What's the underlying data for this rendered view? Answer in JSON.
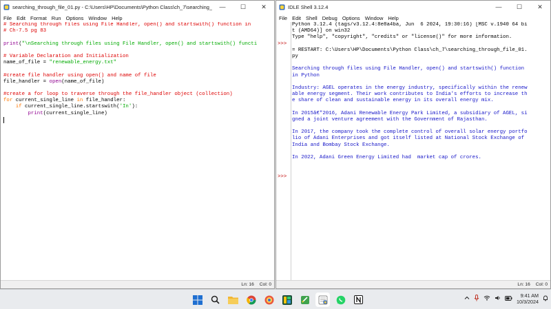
{
  "editor": {
    "title": "searching_through_file_01.py - C:\\Users\\HP\\Documents\\Python Class\\ch_7\\searching_through_f...",
    "menu": [
      "File",
      "Edit",
      "Format",
      "Run",
      "Options",
      "Window",
      "Help"
    ],
    "lines": [
      [
        {
          "t": "# Searching through files using File Handler, open() and startswith() function in",
          "c": "comment"
        }
      ],
      [
        {
          "t": "# Ch-7.5 pg 83",
          "c": "comment"
        }
      ],
      [],
      [
        {
          "t": "print",
          "c": "builtin"
        },
        {
          "t": "(",
          "c": "normal"
        },
        {
          "t": "\"\\nSearching through files using File Handler, open() and startswith() functi",
          "c": "string"
        }
      ],
      [],
      [
        {
          "t": "# Variable Declaration and Initialization",
          "c": "comment"
        }
      ],
      [
        {
          "t": "name_of_file = ",
          "c": "normal"
        },
        {
          "t": "\"renewable_energy.txt\"",
          "c": "string"
        }
      ],
      [],
      [
        {
          "t": "#create file handler using open() and name of file",
          "c": "comment"
        }
      ],
      [
        {
          "t": "file_handler = ",
          "c": "normal"
        },
        {
          "t": "open",
          "c": "builtin"
        },
        {
          "t": "(name_of_file)",
          "c": "normal"
        }
      ],
      [],
      [
        {
          "t": "#create a for loop to traverse through the file_handler object (collection)",
          "c": "comment"
        }
      ],
      [
        {
          "t": "for",
          "c": "keyword"
        },
        {
          "t": " current_single_line ",
          "c": "normal"
        },
        {
          "t": "in",
          "c": "keyword"
        },
        {
          "t": " file_handler:",
          "c": "normal"
        }
      ],
      [
        {
          "t": "    ",
          "c": "normal"
        },
        {
          "t": "if",
          "c": "keyword"
        },
        {
          "t": " current_single_line.startswith(",
          "c": "normal"
        },
        {
          "t": "'In'",
          "c": "string"
        },
        {
          "t": "):",
          "c": "normal"
        }
      ],
      [
        {
          "t": "        ",
          "c": "normal"
        },
        {
          "t": "print",
          "c": "builtin"
        },
        {
          "t": "(current_single_line)",
          "c": "normal"
        }
      ],
      []
    ],
    "status_ln": "Ln: 16",
    "status_col": "Col: 0"
  },
  "shell": {
    "title": "IDLE Shell 3.12.4",
    "menu": [
      "File",
      "Edit",
      "Shell",
      "Debug",
      "Options",
      "Window",
      "Help"
    ],
    "prompt": ">>>",
    "gutter": [
      "",
      "",
      "",
      ">>>",
      "",
      "",
      "",
      "",
      "",
      "",
      "",
      "",
      "",
      "",
      "",
      "",
      "",
      "",
      "",
      "",
      "",
      "",
      "",
      "",
      ">>>"
    ],
    "lines": [
      [
        {
          "t": "Python 3.12.4 (tags/v3.12.4:8e8a4ba, Jun  6 2024, 19:30:16) [MSC v.1940 64 bi",
          "c": "normal"
        }
      ],
      [
        {
          "t": "t (AMD64)] on win32",
          "c": "normal"
        }
      ],
      [
        {
          "t": "Type \"help\", \"copyright\", \"credits\" or \"license()\" for more information.",
          "c": "normal"
        }
      ],
      [],
      [
        {
          "t": "= RESTART: C:\\Users\\HP\\Documents\\Python Class\\ch_7\\searching_through_file_01.",
          "c": "normal"
        }
      ],
      [
        {
          "t": "py",
          "c": "normal"
        }
      ],
      [],
      [
        {
          "t": "Searching through files using File Handler, open() and startswith() function",
          "c": "out"
        }
      ],
      [
        {
          "t": "in Python",
          "c": "out"
        }
      ],
      [],
      [
        {
          "t": "Industry: AGEL operates in the energy industry, specifically within the renew",
          "c": "out"
        }
      ],
      [
        {
          "t": "able energy segment. Their work contributes to India's efforts to increase th",
          "c": "out"
        }
      ],
      [
        {
          "t": "e share of clean and sustainable energy in its overall energy mix.",
          "c": "out"
        }
      ],
      [],
      [
        {
          "t": "In 2015â€\"2016, Adani Renewable Energy Park Limited, a subsidiary of AGEL, si",
          "c": "out"
        }
      ],
      [
        {
          "t": "gned a joint venture agreement with the Government of Rajasthan.",
          "c": "out"
        }
      ],
      [],
      [
        {
          "t": "In 2017, the company took the complete control of overall solar energy portfo",
          "c": "out"
        }
      ],
      [
        {
          "t": "lio of Adani Enterprises and got itself listed at National Stock Exchange of",
          "c": "out"
        }
      ],
      [
        {
          "t": "India and Bombay Stock Exchange.",
          "c": "out"
        }
      ],
      [],
      [
        {
          "t": "In 2022, Adani Green Energy Limited had  market cap of crores.",
          "c": "out"
        }
      ],
      [],
      [],
      []
    ],
    "status_ln": "Ln: 16",
    "status_col": "Col: 0"
  },
  "window_controls": {
    "minimize": "—",
    "maximize": "☐",
    "close": "✕"
  },
  "taskbar": {
    "apps": [
      {
        "name": "windows-start",
        "color": "#1f6fd1"
      },
      {
        "name": "search",
        "color": "#222222"
      },
      {
        "name": "file-explorer",
        "color": "#f2b632"
      },
      {
        "name": "chrome",
        "color": "#db4437"
      },
      {
        "name": "browser-alt",
        "color": "#d23f31"
      },
      {
        "name": "editor-app",
        "color": "#2e8b57"
      },
      {
        "name": "notepad-green",
        "color": "#3fa34d"
      },
      {
        "name": "python-idle",
        "color": "#3b6fb6"
      },
      {
        "name": "whatsapp",
        "color": "#25d366"
      },
      {
        "name": "notion",
        "color": "#111111"
      }
    ],
    "time": "9:41 AM",
    "date": "10/3/2024"
  }
}
